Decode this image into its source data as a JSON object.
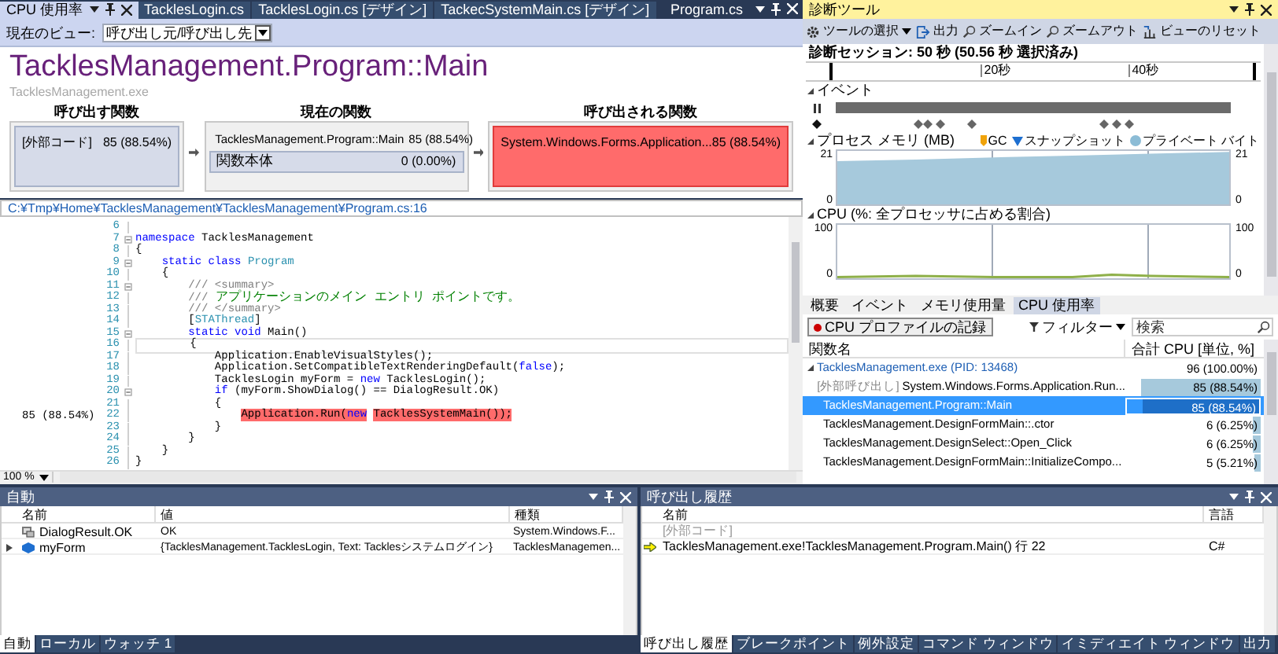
{
  "doc_tabs": [
    {
      "label": "CPU 使用率",
      "selected": true
    },
    {
      "label": "TacklesLogin.cs",
      "selected": false
    },
    {
      "label": "TacklesLogin.cs [デザイン]",
      "selected": false
    },
    {
      "label": "TackecSystemMain.cs [デザイン]",
      "selected": false
    }
  ],
  "preview_tab": {
    "label": "Program.cs"
  },
  "view_bar": {
    "label": "現在のビュー:",
    "value": "呼び出し元/呼び出し先"
  },
  "function": {
    "name": "TacklesManagement.Program::Main",
    "module": "TacklesManagement.exe"
  },
  "caller": {
    "heading": "呼び出す関数",
    "items": [
      {
        "name": "[外部コード]",
        "value": "85 (88.54%)",
        "hot": false
      }
    ]
  },
  "current": {
    "heading": "現在の関数",
    "name": "TacklesManagement.Program::Main",
    "value": "85 (88.54%)",
    "body": {
      "name": "関数本体",
      "value": "0 (0.00%)"
    }
  },
  "callee": {
    "heading": "呼び出される関数",
    "items": [
      {
        "name": "System.Windows.Forms.Application...",
        "value": "85 (88.54%)",
        "hot": true
      }
    ]
  },
  "code": {
    "path": "C:¥Tmp¥Home¥TacklesManagement¥TacklesManagement¥Program.cs:16",
    "zoom": "100 %",
    "lines": [
      {
        "n": "6",
        "fold": false,
        "current": false,
        "hot": false
      },
      {
        "n": "7",
        "fold": true,
        "current": false,
        "hot": false,
        "tokens": [
          {
            "kind": "keyword",
            "text": "namespace"
          },
          {
            "kind": "plain",
            "text": " TacklesManagement"
          }
        ]
      },
      {
        "n": "8",
        "fold": false,
        "current": false,
        "hot": false,
        "tokens": [
          {
            "kind": "plain",
            "text": "{"
          }
        ]
      },
      {
        "n": "9",
        "fold": true,
        "current": false,
        "hot": false,
        "tokens": [
          {
            "kind": "keyword",
            "text": "    static class"
          },
          {
            "kind": "type",
            "text": " Program"
          }
        ]
      },
      {
        "n": "10",
        "fold": false,
        "current": false,
        "hot": false,
        "tokens": [
          {
            "kind": "plain",
            "text": "    {"
          }
        ]
      },
      {
        "n": "11",
        "fold": true,
        "current": false,
        "hot": false,
        "tokens": [
          {
            "kind": "doc",
            "text": "        /// <summary>"
          }
        ]
      },
      {
        "n": "12",
        "fold": false,
        "current": false,
        "hot": false,
        "tokens": [
          {
            "kind": "doc",
            "text": "        ///"
          },
          {
            "kind": "comment",
            "text": " アプリケーションのメイン エントリ ポイントです。"
          }
        ]
      },
      {
        "n": "13",
        "fold": false,
        "current": false,
        "hot": false,
        "tokens": [
          {
            "kind": "doc",
            "text": "        /// </summary>"
          }
        ]
      },
      {
        "n": "14",
        "fold": false,
        "current": false,
        "hot": false,
        "tokens": [
          {
            "kind": "plain",
            "text": "        ["
          },
          {
            "kind": "type",
            "text": "STAThread"
          },
          {
            "kind": "plain",
            "text": "]"
          }
        ]
      },
      {
        "n": "15",
        "fold": true,
        "current": false,
        "hot": false,
        "tokens": [
          {
            "kind": "keyword",
            "text": "        static void"
          },
          {
            "kind": "plain",
            "text": " Main()"
          }
        ]
      },
      {
        "n": "16",
        "fold": false,
        "current": true,
        "hot": false,
        "tokens": [
          {
            "kind": "plain",
            "text": "        {"
          }
        ]
      },
      {
        "n": "17",
        "fold": false,
        "current": false,
        "hot": false,
        "tokens": [
          {
            "kind": "plain",
            "text": "            Application.EnableVisualStyles();"
          }
        ]
      },
      {
        "n": "18",
        "fold": false,
        "current": false,
        "hot": false,
        "tokens": [
          {
            "kind": "plain",
            "text": "            Application.SetCompatibleTextRenderingDefault("
          },
          {
            "kind": "keyword",
            "text": "false"
          },
          {
            "kind": "plain",
            "text": ");"
          }
        ]
      },
      {
        "n": "19",
        "fold": false,
        "current": false,
        "hot": false,
        "tokens": [
          {
            "kind": "plain",
            "text": "            TacklesLogin myForm = "
          },
          {
            "kind": "keyword",
            "text": "new"
          },
          {
            "kind": "plain",
            "text": " TacklesLogin();"
          }
        ]
      },
      {
        "n": "20",
        "fold": true,
        "current": false,
        "hot": false,
        "tokens": [
          {
            "kind": "keyword",
            "text": "            if"
          },
          {
            "kind": "plain",
            "text": " (myForm.ShowDialog() == DialogResult.OK)"
          }
        ]
      },
      {
        "n": "21",
        "fold": false,
        "current": false,
        "hot": false,
        "tokens": [
          {
            "kind": "plain",
            "text": "            {"
          }
        ]
      },
      {
        "n": "22",
        "fold": false,
        "current": false,
        "hot": true,
        "metric": "85 (88.54%)",
        "tokens": [
          {
            "kind": "plain",
            "text": "                Application.Run("
          },
          {
            "kind": "keyword",
            "text": "new"
          },
          {
            "kind": "plain",
            "text": " TacklesSystemMain());"
          }
        ]
      },
      {
        "n": "23",
        "fold": false,
        "current": false,
        "hot": false,
        "tokens": [
          {
            "kind": "plain",
            "text": "            }"
          }
        ]
      },
      {
        "n": "24",
        "fold": false,
        "current": false,
        "hot": false,
        "tokens": [
          {
            "kind": "plain",
            "text": "        }"
          }
        ]
      },
      {
        "n": "25",
        "fold": false,
        "current": false,
        "hot": false,
        "tokens": [
          {
            "kind": "plain",
            "text": "    }"
          }
        ]
      },
      {
        "n": "26",
        "fold": false,
        "current": false,
        "hot": false,
        "tokens": [
          {
            "kind": "plain",
            "text": "}"
          }
        ]
      }
    ]
  },
  "diag": {
    "title": "診断ツール",
    "toolbar": [
      {
        "label": "ツールの選択",
        "kind": "gear"
      },
      {
        "label": "出力",
        "kind": "output"
      },
      {
        "label": "ズームイン",
        "kind": "zoom"
      },
      {
        "label": "ズームアウト",
        "kind": "zoom"
      },
      {
        "label": "ビューのリセット",
        "kind": "reset"
      }
    ],
    "session": "診断セッション: 50 秒 (50.56 秒 選択済み)",
    "ruler_labels": [
      "20秒",
      "40秒"
    ],
    "events": {
      "heading": "イベント"
    },
    "memory": {
      "heading": "プロセス メモリ (MB)",
      "legend": [
        {
          "label": "GC",
          "kind": "marker",
          "color": "#f0a30a"
        },
        {
          "label": "スナップショット",
          "kind": "triangle",
          "color": "#1e6fd0"
        },
        {
          "label": "プライベート バイト",
          "kind": "circle",
          "color": "#8cbcd6"
        }
      ],
      "left_axis": [
        "21",
        "0"
      ],
      "right_axis": [
        "21",
        "0"
      ]
    },
    "cpu": {
      "heading": "CPU (%: 全プロセッサに占める割合)",
      "left_axis": [
        "100",
        "0"
      ],
      "right_axis": [
        "100",
        "0"
      ]
    },
    "tabs": [
      {
        "label": "概要",
        "selected": false
      },
      {
        "label": "イベント",
        "selected": false
      },
      {
        "label": "メモリ使用量",
        "selected": false
      },
      {
        "label": "CPU 使用率",
        "selected": true
      }
    ],
    "record_button": "CPU プロファイルの記録",
    "filter": "フィルター",
    "search": {
      "placeholder": "検索"
    },
    "columns": [
      "関数名",
      "合計 CPU [単位, %]"
    ],
    "rows": [
      {
        "name": "TacklesManagement.exe (PID: 13468)",
        "value": "96 (100.00%)",
        "selected": false,
        "expanded": true,
        "children": [
          {
            "prefix": "[外部呼び出し]",
            "name": "System.Windows.Forms.Application.Run...",
            "value": "85 (88.54%)",
            "level": 0.8854,
            "selected": false
          },
          {
            "name": "TacklesManagement.Program::Main",
            "value": "85 (88.54%)",
            "level": 0.8854,
            "selected": true
          },
          {
            "name": "TacklesManagement.DesignFormMain::.ctor",
            "value": "6 (6.25%)",
            "level": 0.0625,
            "selected": false
          },
          {
            "name": "TacklesManagement.DesignSelect::Open_Click",
            "value": "6 (6.25%)",
            "level": 0.0625,
            "selected": false
          },
          {
            "name": "TacklesManagement.DesignFormMain::InitializeCompo...",
            "value": "5 (5.21%)",
            "level": 0.0521,
            "selected": false
          }
        ]
      }
    ]
  },
  "autos": {
    "title": "自動",
    "columns": [
      "名前",
      "値",
      "種類"
    ],
    "rows": [
      {
        "name": "DialogResult.OK",
        "value": "OK",
        "type": "System.Windows.F...",
        "kind": "enum",
        "expandable": false
      },
      {
        "name": "myForm",
        "value": "{TacklesManagement.TacklesLogin, Text: Tacklesシステムログイン}",
        "type": "TacklesManagemen...",
        "kind": "object",
        "expandable": true
      }
    ],
    "tabs": [
      {
        "label": "自動",
        "selected": true
      },
      {
        "label": "ローカル",
        "selected": false
      },
      {
        "label": "ウォッチ 1",
        "selected": false
      }
    ]
  },
  "callstack": {
    "title": "呼び出し履歴",
    "columns": [
      "名前",
      "言語"
    ],
    "rows": [
      {
        "name": "[外部コード]",
        "external": true,
        "current": false
      },
      {
        "name": "TacklesManagement.exe!TacklesManagement.Program.Main() 行 22",
        "language": "C#",
        "external": false,
        "current": true
      }
    ],
    "tabs": [
      {
        "label": "呼び出し履歴",
        "selected": true
      },
      {
        "label": "ブレークポイント",
        "selected": false
      },
      {
        "label": "例外設定",
        "selected": false
      },
      {
        "label": "コマンド ウィンドウ",
        "selected": false
      },
      {
        "label": "イミディエイト ウィンドウ",
        "selected": false
      },
      {
        "label": "出力",
        "selected": false
      }
    ]
  }
}
